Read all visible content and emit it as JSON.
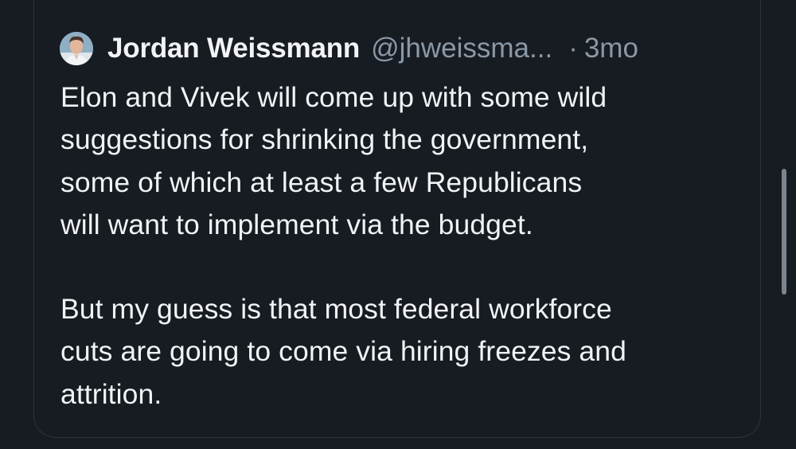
{
  "tweet": {
    "author_name": "Jordan Weissmann",
    "author_handle": "@jhweissma...",
    "separator": "·",
    "timestamp": "3mo",
    "paragraphs": [
      {
        "lines": [
          "Elon and Vivek will come up with some wild",
          "suggestions for shrinking the government,",
          "some of which at least a few Republicans",
          "will want to implement via the budget."
        ]
      },
      {
        "lines": [
          "But my guess is that most federal workforce",
          "cuts are going to come via hiring freezes and",
          "attrition."
        ]
      }
    ]
  },
  "icons": {
    "avatar": "profile-photo"
  },
  "colors": {
    "background": "#171c23",
    "primary_text": "#f1f3f5",
    "secondary_text": "#8b98a5",
    "card_border": "#2e353e",
    "scrollbar": "#7b8590"
  }
}
